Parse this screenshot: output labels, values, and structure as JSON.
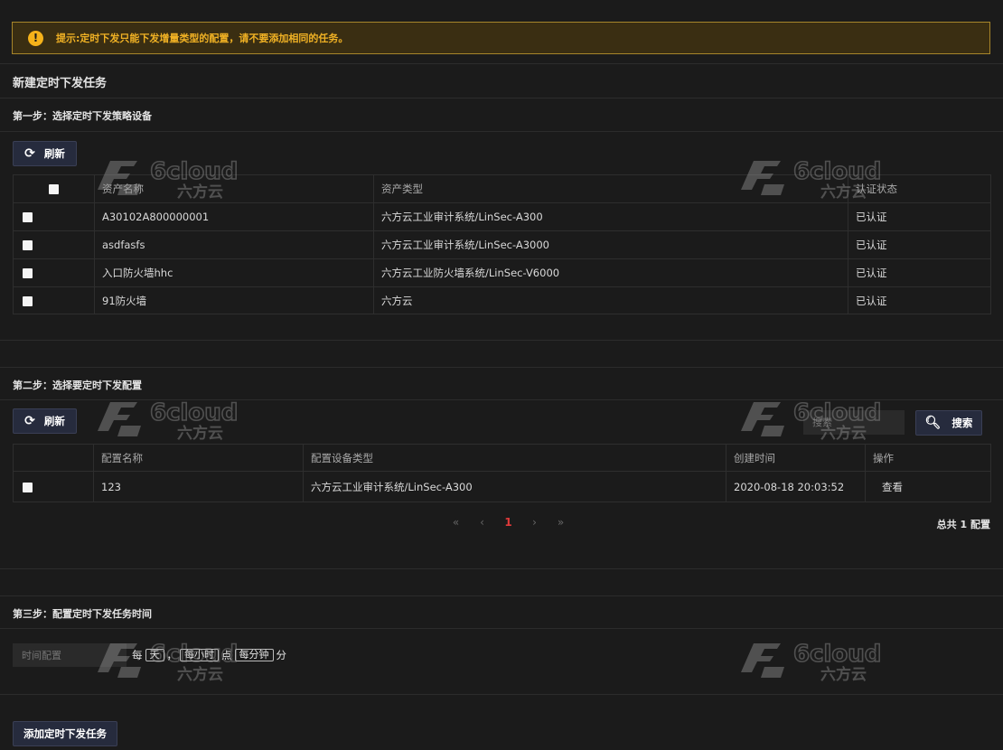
{
  "alert": {
    "icon": "warning-icon",
    "text": "提示:定时下发只能下发增量类型的配置，请不要添加相同的任务。"
  },
  "page_title": "新建定时下发任务",
  "watermark": {
    "brand": "6cloud",
    "sub": "六方云"
  },
  "step1": {
    "title": "第一步：选择定时下发策略设备",
    "refresh_label": "刷新",
    "headers": [
      "资产名称",
      "资产类型",
      "认证状态"
    ],
    "rows": [
      {
        "name": "A30102A800000001",
        "type": "六方云工业审计系统/LinSec-A300",
        "status": "已认证"
      },
      {
        "name": "asdfasfs",
        "type": "六方云工业审计系统/LinSec-A3000",
        "status": "已认证"
      },
      {
        "name": "入口防火墙hhc",
        "type": "六方云工业防火墙系统/LinSec-V6000",
        "status": "已认证"
      },
      {
        "name": "91防火墙",
        "type": "六方云",
        "status": "已认证"
      }
    ]
  },
  "step2": {
    "title": "第二步：选择要定时下发配置",
    "refresh_label": "刷新",
    "search_placeholder": "搜索",
    "search_label": "搜索",
    "headers": [
      "配置名称",
      "配置设备类型",
      "创建时间",
      "操作"
    ],
    "rows": [
      {
        "name": "123",
        "device_type": "六方云工业审计系统/LinSec-A300",
        "created": "2020-08-18 20:03:52",
        "action": "查看"
      }
    ],
    "pager": {
      "first": "«",
      "prev": "‹",
      "current": "1",
      "next": "›",
      "last": "»"
    },
    "total": "总共 1 配置"
  },
  "step3": {
    "title": "第三步：配置定时下发任务时间",
    "time_placeholder": "时间配置",
    "cron": {
      "every": "每",
      "day": "天",
      "comma": "，",
      "hour": "每小时",
      "point": "点",
      "minute": "每分钟",
      "unit": "分"
    }
  },
  "submit_label": "添加定时下发任务"
}
